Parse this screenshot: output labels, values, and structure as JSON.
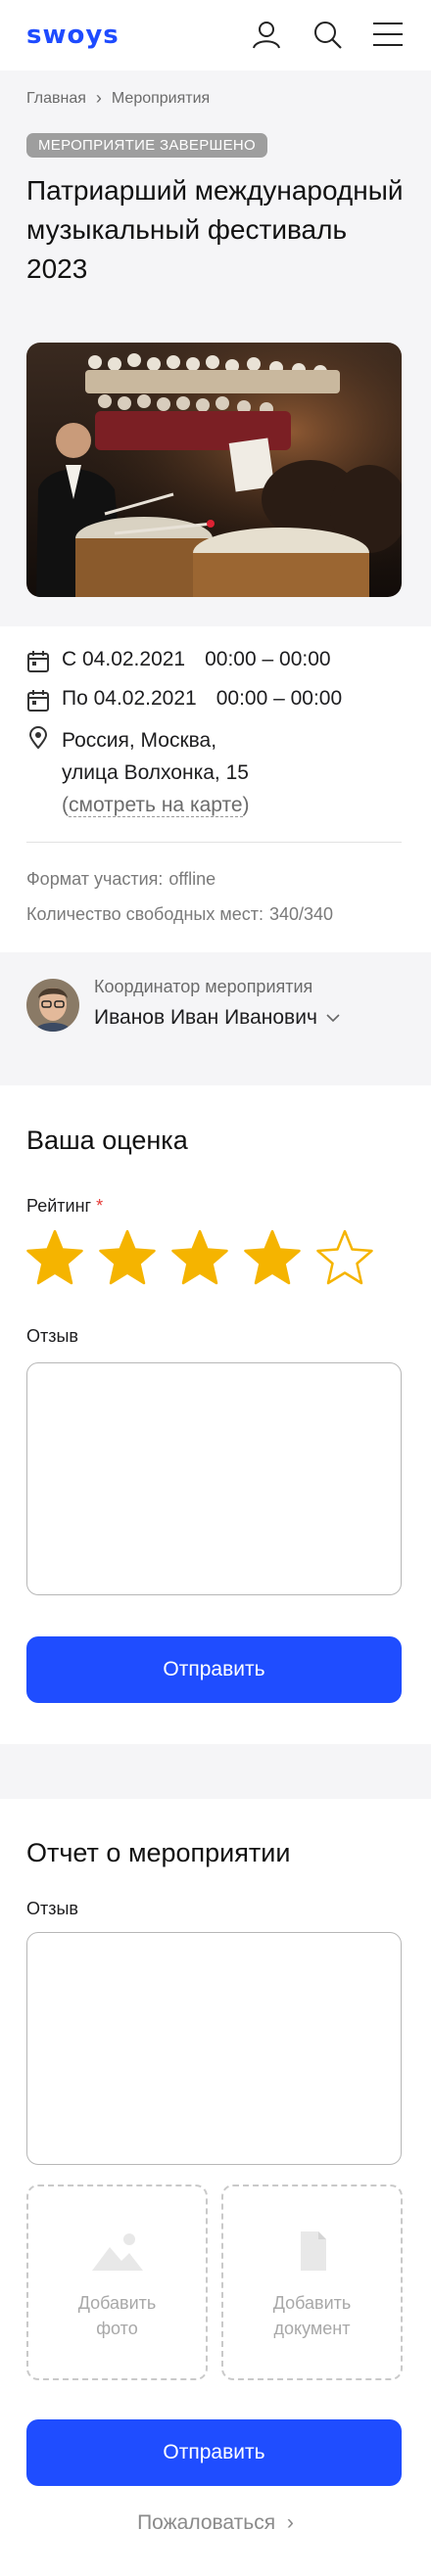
{
  "header": {
    "logo": "swoys",
    "icons": [
      "user-icon",
      "search-icon",
      "menu-icon"
    ]
  },
  "breadcrumb": {
    "items": [
      "Главная",
      "Мероприятия"
    ]
  },
  "event": {
    "status_badge": "МЕРОПРИЯТИЕ ЗАВЕРШЕНО",
    "title": "Патриарший международный музыкальный фестиваль 2023",
    "start_date": "С 04.02.2021",
    "start_time": "00:00 – 00:00",
    "end_date": "По 04.02.2021",
    "end_time": "00:00 – 00:00",
    "address_line1": "Россия, Москва,",
    "address_line2": "улица Волхонка, 15",
    "map_link": "смотреть на карте",
    "format_label": "Формат участия:",
    "format_value": "offline",
    "seats_label": "Количество свободных мест:",
    "seats_value": "340/340"
  },
  "coordinator": {
    "label": "Координатор мероприятия",
    "name": "Иванов Иван Иванович"
  },
  "rating_section": {
    "title": "Ваша оценка",
    "rating_label": "Рейтинг",
    "required_mark": "*",
    "rating_value": 4,
    "rating_max": 5,
    "review_label": "Отзыв",
    "submit_label": "Отправить"
  },
  "report_section": {
    "title": "Отчет о мероприятии",
    "review_label": "Отзыв",
    "add_photo_line1": "Добавить",
    "add_photo_line2": "фото",
    "add_doc_line1": "Добавить",
    "add_doc_line2": "документ",
    "submit_label": "Отправить"
  },
  "complain_label": "Пожаловаться",
  "colors": {
    "brand": "#1e4bff",
    "button": "#1f4dff",
    "star": "#f5b400",
    "badge": "#9e9e9e",
    "required": "#e53935"
  }
}
